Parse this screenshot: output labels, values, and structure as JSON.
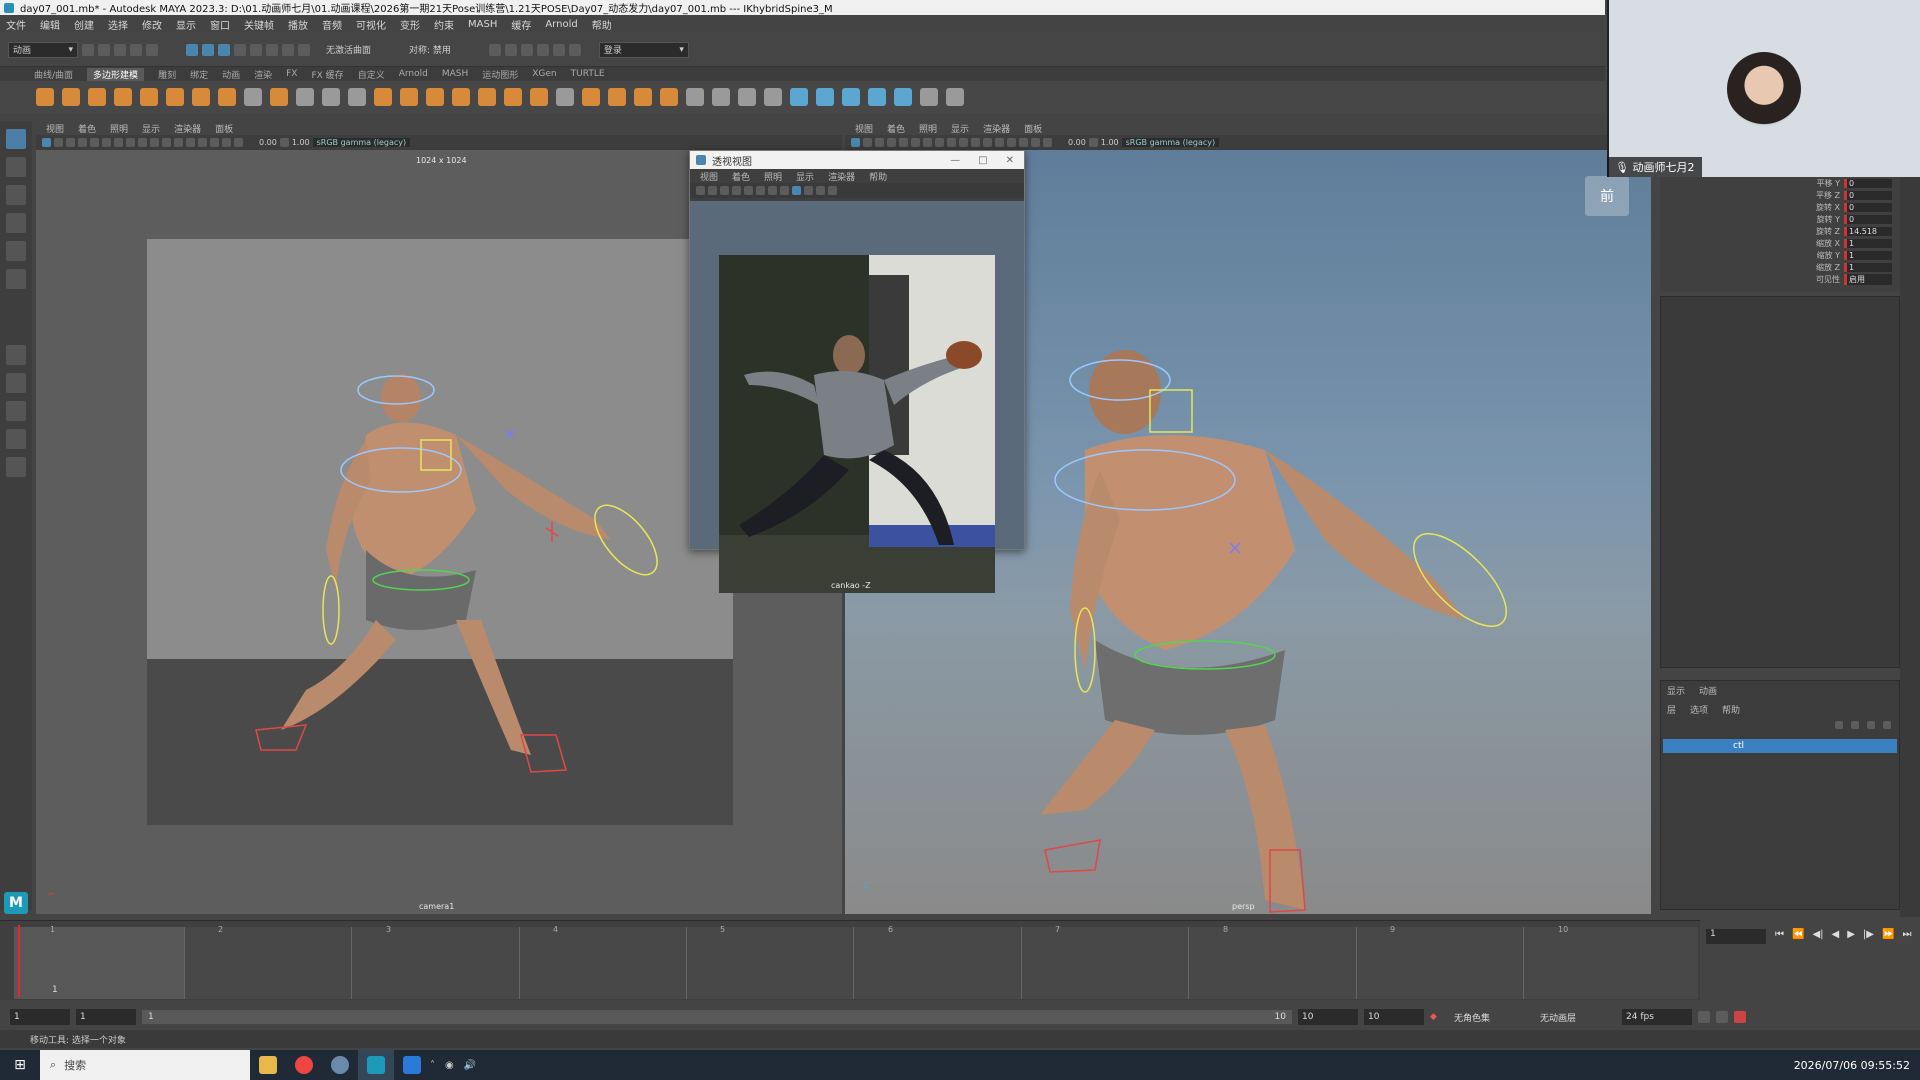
{
  "window": {
    "title": "day07_001.mb* - Autodesk MAYA 2023.3: D:\\01.动画师七月\\01.动画课程\\2026第一期21天Pose训练营\\1.21天POSE\\Day07_动态发力\\day07_001.mb   ---   IKhybridSpine3_M"
  },
  "menubar": {
    "items": [
      "文件",
      "编辑",
      "创建",
      "选择",
      "修改",
      "显示",
      "窗口",
      "关键帧",
      "播放",
      "音频",
      "可视化",
      "变形",
      "约束",
      "MASH",
      "缓存",
      "Arnold",
      "帮助"
    ]
  },
  "statusline": {
    "mode": "动画",
    "no_live_surface": "无激活曲面",
    "symmetry": "对称: 禁用",
    "login": "登录"
  },
  "shelf": {
    "tabs": [
      "曲线/曲面",
      "多边形建模",
      "雕刻",
      "绑定",
      "动画",
      "渲染",
      "FX",
      "FX 缓存",
      "自定义",
      "Arnold",
      "MASH",
      "运动图形",
      "XGen",
      "TURTLE"
    ],
    "active_tab": "多边形建模"
  },
  "viewport_left": {
    "menu": [
      "视图",
      "着色",
      "照明",
      "显示",
      "渲染器",
      "面板"
    ],
    "exposure": "0.00",
    "gamma": "1.00",
    "colorspace": "sRGB gamma (legacy)",
    "resolution": "1024 x 1024",
    "camera": "camera1"
  },
  "viewport_right": {
    "menu": [
      "视图",
      "着色",
      "照明",
      "显示",
      "渲染器",
      "面板"
    ],
    "exposure": "0.00",
    "gamma": "1.00",
    "colorspace": "sRGB gamma (legacy)",
    "camera": "persp",
    "viewcube": "前"
  },
  "reference_window": {
    "title": "透视视图",
    "menu": [
      "视图",
      "着色",
      "照明",
      "显示",
      "渲染器",
      "帮助"
    ],
    "camera": "cankao -Z"
  },
  "webcam": {
    "name": "动画师七月2"
  },
  "channel_box": {
    "rows": [
      {
        "label": "平移 Y",
        "value": "0"
      },
      {
        "label": "平移 Z",
        "value": "0"
      },
      {
        "label": "旋转 X",
        "value": "0"
      },
      {
        "label": "旋转 Y",
        "value": "0"
      },
      {
        "label": "旋转 Z",
        "value": "14.518"
      },
      {
        "label": "缩放 X",
        "value": "1"
      },
      {
        "label": "缩放 Y",
        "value": "1"
      },
      {
        "label": "缩放 Z",
        "value": "1"
      },
      {
        "label": "可见性",
        "value": "启用"
      }
    ]
  },
  "layer_editor": {
    "tabs": [
      "显示",
      "动画"
    ],
    "menu": [
      "层",
      "选项",
      "帮助"
    ],
    "layer_name": "ctl"
  },
  "timeline": {
    "ticks": [
      "1",
      "2",
      "3",
      "4",
      "5",
      "6",
      "7",
      "8",
      "9",
      "10"
    ],
    "current_frame": "1",
    "current_frame_marker": "1"
  },
  "range": {
    "start": "1",
    "playback_start": "1",
    "slider_start": "1",
    "slider_end": "10",
    "playback_end": "10",
    "end": "10",
    "character_set": "无角色集",
    "anim_layer": "无动画层",
    "fps": "24 fps"
  },
  "helpline": {
    "text": "移动工具: 选择一个对象"
  },
  "taskbar": {
    "search": "搜索",
    "datetime": "2026/07/06 09:55:52"
  },
  "colors": {
    "accent_selection": "#3a7fbf",
    "channel_key_red": "#cc3333",
    "maya_logo": "#1c9ab8"
  }
}
